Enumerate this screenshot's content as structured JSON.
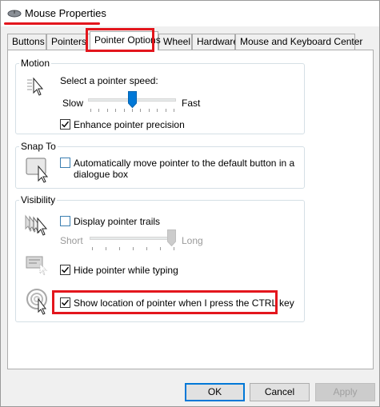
{
  "window": {
    "title": "Mouse Properties",
    "icon": "mouse-icon",
    "highlight_color": "#e3161d"
  },
  "tabs": [
    {
      "label": "Buttons",
      "active": false
    },
    {
      "label": "Pointers",
      "active": false
    },
    {
      "label": "Pointer Options",
      "active": true
    },
    {
      "label": "Wheel",
      "active": false
    },
    {
      "label": "Hardware",
      "active": false
    },
    {
      "label": "Mouse and Keyboard Center",
      "active": false
    }
  ],
  "motion": {
    "legend": "Motion",
    "icon": "pointer-speed-icon",
    "speed_label": "Select a pointer speed:",
    "slow_label": "Slow",
    "fast_label": "Fast",
    "speed_level": 0.5,
    "enhance_label": "Enhance pointer precision",
    "enhance_checked": true
  },
  "snap_to": {
    "legend": "Snap To",
    "icon": "snap-to-button-icon",
    "line1": "Automatically move pointer to the default button in a",
    "line2": "dialogue box",
    "checked": false
  },
  "visibility": {
    "legend": "Visibility",
    "trails_icon": "pointer-trails-icon",
    "trails_label": "Display pointer trails",
    "trails_checked": false,
    "short_label": "Short",
    "long_label": "Long",
    "trail_level": 1.0,
    "hide_icon": "hide-pointer-icon",
    "hide_label": "Hide pointer while typing",
    "hide_checked": true,
    "ctrl_icon": "ctrl-locate-icon",
    "ctrl_label": "Show location of pointer when I press the CTRL key",
    "ctrl_checked": true
  },
  "buttons": {
    "ok": "OK",
    "cancel": "Cancel",
    "apply": "Apply"
  }
}
